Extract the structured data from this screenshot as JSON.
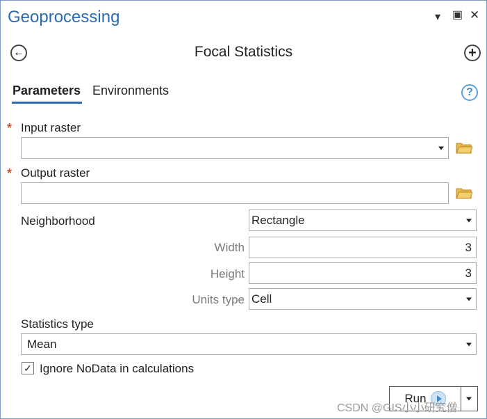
{
  "window": {
    "title": "Geoprocessing",
    "menu_glyph": "▾",
    "maximize_glyph": "▣",
    "close_glyph": "✕"
  },
  "tool": {
    "title": "Focal Statistics",
    "back_glyph": "←",
    "add_glyph": "+"
  },
  "tabs": {
    "parameters": "Parameters",
    "environments": "Environments",
    "help_glyph": "?"
  },
  "params": {
    "required_marker": "*",
    "input_raster_label": "Input raster",
    "input_raster_value": "",
    "output_raster_label": "Output raster",
    "output_raster_value": "",
    "neighborhood_label": "Neighborhood",
    "neighborhood_value": "Rectangle",
    "width_label": "Width",
    "width_value": "3",
    "height_label": "Height",
    "height_value": "3",
    "units_type_label": "Units type",
    "units_type_value": "Cell",
    "statistics_type_label": "Statistics type",
    "statistics_type_value": "Mean",
    "ignore_nodata_label": "Ignore NoData in calculations",
    "ignore_nodata_checked": true,
    "check_glyph": "✓"
  },
  "footer": {
    "run_label": "Run",
    "watermark": "CSDN @GIS小小研究僧"
  },
  "colors": {
    "accent": "#2b6cb0",
    "required": "#c0592f",
    "folder": "#e8b84a"
  }
}
